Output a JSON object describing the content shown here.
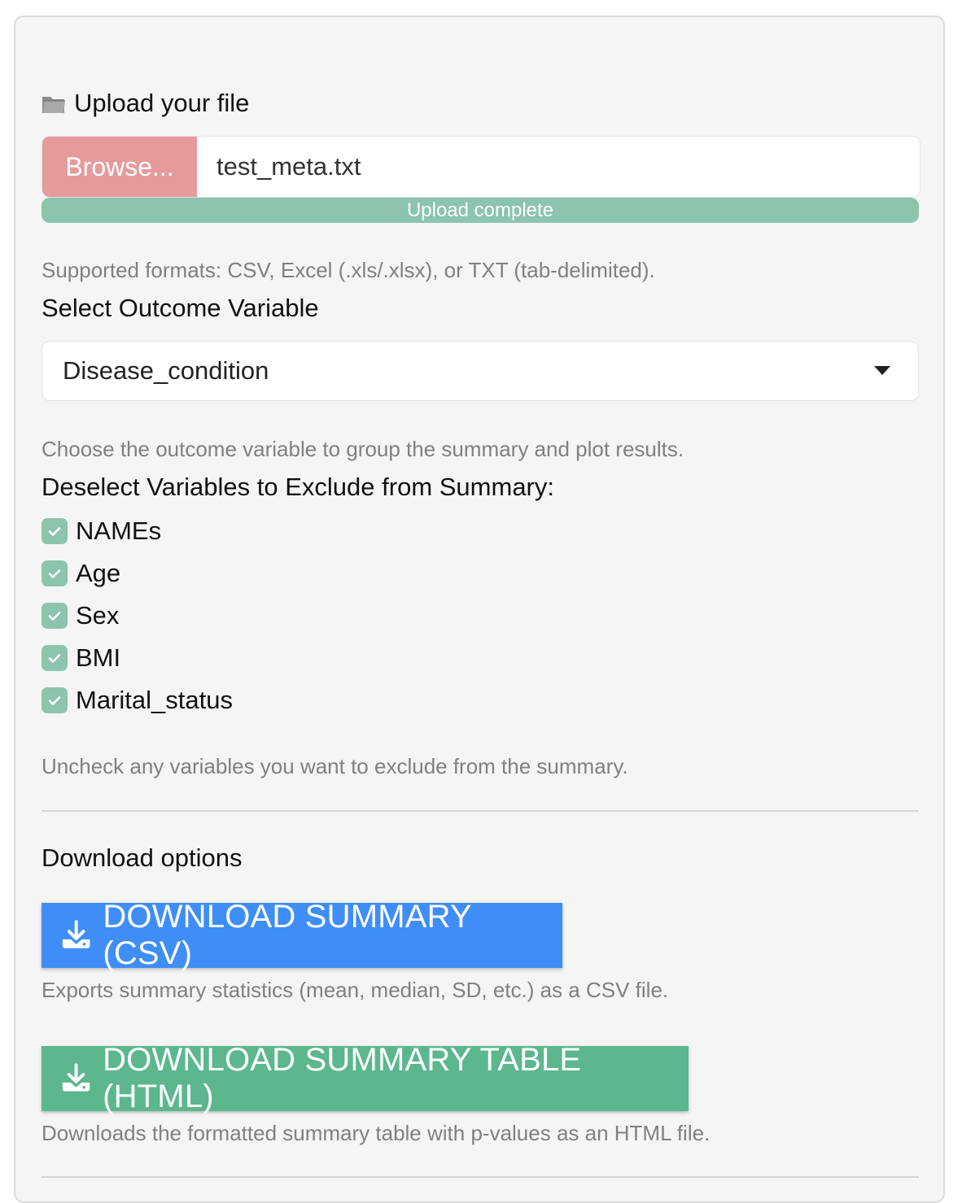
{
  "upload": {
    "label": "Upload your file",
    "browse_label": "Browse...",
    "file_name": "test_meta.txt",
    "progress_text": "Upload complete",
    "progress": 1.0,
    "help": "Supported formats: CSV, Excel (.xls/.xlsx), or TXT (tab-delimited)."
  },
  "outcome": {
    "label": "Select Outcome Variable",
    "selected": "Disease_condition",
    "help": "Choose the outcome variable to group the summary and plot results."
  },
  "exclude": {
    "label": "Deselect Variables to Exclude from Summary:",
    "items": [
      {
        "label": "NAMEs",
        "checked": true
      },
      {
        "label": "Age",
        "checked": true
      },
      {
        "label": "Sex",
        "checked": true
      },
      {
        "label": "BMI",
        "checked": true
      },
      {
        "label": "Marital_status",
        "checked": true
      }
    ],
    "help": "Uncheck any variables you want to exclude from the summary."
  },
  "download": {
    "label": "Download options",
    "csv_button": "DOWNLOAD SUMMARY (CSV)",
    "csv_help": "Exports summary statistics (mean, median, SD, etc.) as a CSV file.",
    "html_button": "DOWNLOAD SUMMARY TABLE (HTML)",
    "html_help": "Downloads the formatted summary table with p-values as an HTML file."
  },
  "colors": {
    "browse": "#e69a9b",
    "progress": "#8dc4ae",
    "checkbox": "#8dc4ae",
    "csv_button": "#3f8ef7",
    "html_button": "#5cb78e"
  },
  "icons": [
    "folder-icon",
    "checkmark-icon",
    "download-icon",
    "chevron-down-icon"
  ]
}
